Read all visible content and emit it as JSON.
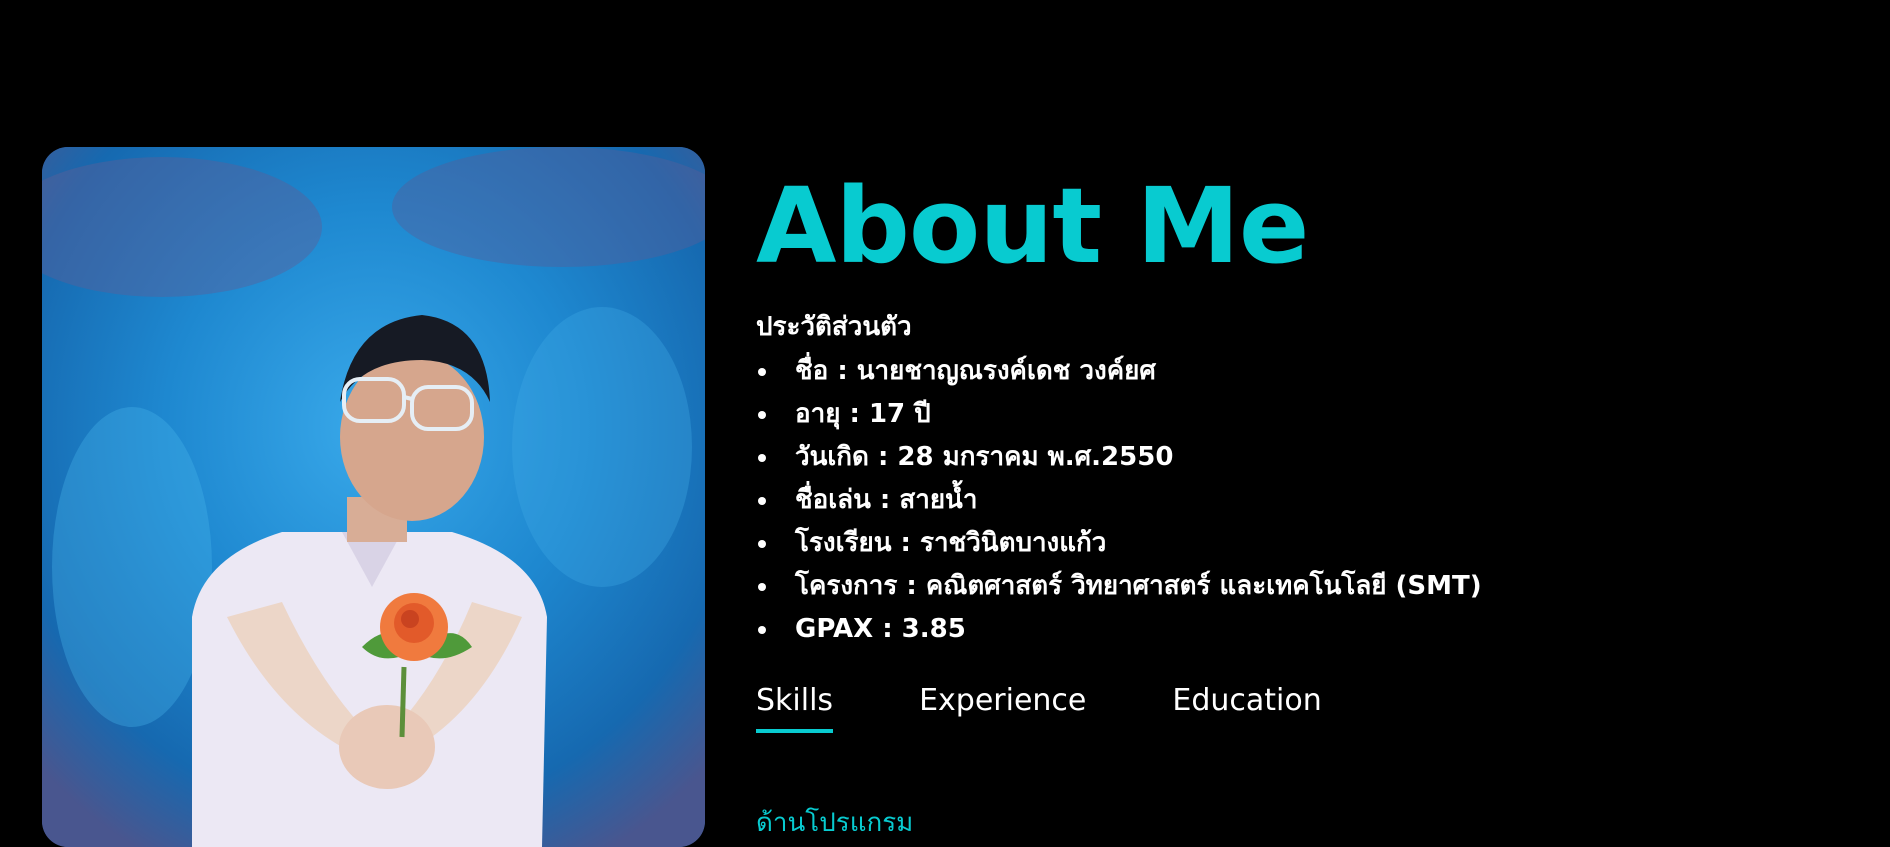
{
  "colors": {
    "background": "#000000",
    "accent": "#08cbd0",
    "text": "#ffffff"
  },
  "about": {
    "heading": "About Me",
    "subheading": "ประวัติส่วนตัว",
    "items": [
      "ชื่อ : นายชาญณรงค์เดช วงค์ยศ",
      "อายุ : 17 ปี",
      "วันเกิด : 28 มกราคม พ.ศ.2550",
      "ชื่อเล่น : สายน้ำ",
      "โรงเรียน : ราชวินิตบางแก้ว",
      "โครงการ : คณิตศาสตร์ วิทยาศาสตร์ และเทคโนโลยี (SMT)",
      "GPAX : 3.85"
    ]
  },
  "tabs": [
    {
      "label": "Skills",
      "active": true
    },
    {
      "label": "Experience",
      "active": false
    },
    {
      "label": "Education",
      "active": false
    }
  ],
  "tab_content": {
    "first_line": "ด้านโปรแกรม"
  },
  "photo": {
    "description_icon": "portrait-photo"
  }
}
